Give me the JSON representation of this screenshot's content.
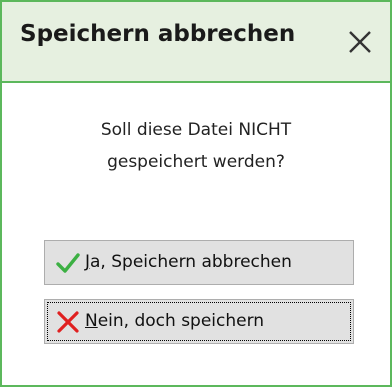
{
  "dialog": {
    "title": "Speichern abbrechen",
    "close_icon": "close-icon",
    "message_line1": "Soll diese Datei NICHT",
    "message_line2": "gespeichert werden?",
    "accent_color": "#5cb85c",
    "titlebar_color": "#e6f0e0"
  },
  "buttons": {
    "yes": {
      "mnemonic": "J",
      "label_rest": "a, Speichern abbrechen",
      "icon": "checkmark-icon",
      "icon_color": "#3cb043"
    },
    "no": {
      "mnemonic": "N",
      "label_rest": "ein, doch speichern",
      "icon": "cross-icon",
      "icon_color": "#e02020",
      "focused": true
    }
  }
}
